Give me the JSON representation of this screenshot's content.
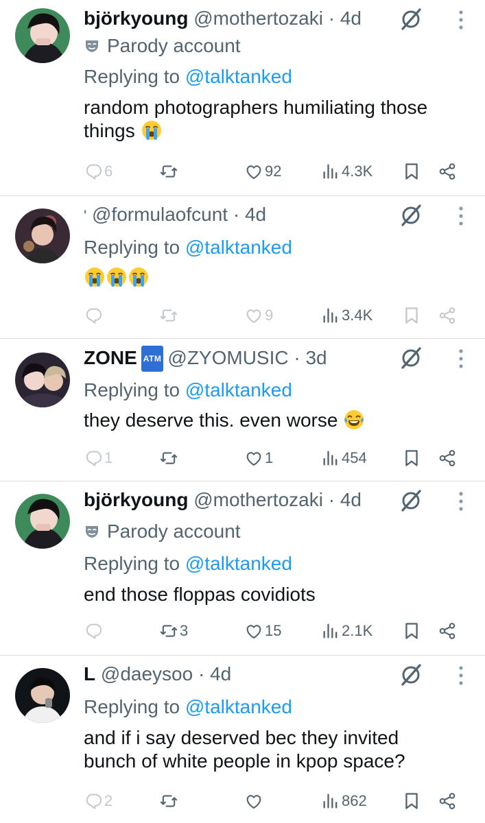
{
  "tweets": [
    {
      "name": "björkyoung",
      "handle": "@mothertozaki",
      "time": "4d",
      "parody": "Parody account",
      "replying_prefix": "Replying to",
      "replying_to": "@talktanked",
      "text_lines": [
        "random photographers humiliating those",
        "things"
      ],
      "emoji": [
        "crying-face"
      ],
      "replies": "6",
      "reposts": "",
      "likes": "92",
      "views": "4.3K"
    },
    {
      "name": "'",
      "handle": "@formulaofcunt",
      "time": "4d",
      "replying_prefix": "Replying to",
      "replying_to": "@talktanked",
      "emoji": [
        "crying-face",
        "crying-face",
        "crying-face"
      ],
      "replies": "",
      "reposts": "",
      "likes": "9",
      "views": "3.4K"
    },
    {
      "name": "ZONE",
      "badge": "ATM",
      "handle": "@ZYOMUSIC",
      "time": "3d",
      "replying_prefix": "Replying to",
      "replying_to": "@talktanked",
      "text_lines": [
        "they deserve this. even worse"
      ],
      "emoji": [
        "laughing-tears-face"
      ],
      "replies": "1",
      "reposts": "",
      "likes": "1",
      "views": "454"
    },
    {
      "name": "björkyoung",
      "handle": "@mothertozaki",
      "time": "4d",
      "parody": "Parody account",
      "replying_prefix": "Replying to",
      "replying_to": "@talktanked",
      "text_lines": [
        "end those floppas covidiots"
      ],
      "replies": "",
      "reposts": "3",
      "likes": "15",
      "views": "2.1K"
    },
    {
      "name": "L",
      "handle": "@daeysoo",
      "time": "4d",
      "replying_prefix": "Replying to",
      "replying_to": "@talktanked",
      "text_lines": [
        "and if i say deserved bec they invited",
        "bunch of white people in kpop space?"
      ],
      "replies": "2",
      "reposts": "",
      "likes": "",
      "views": "862"
    }
  ],
  "separator": "·",
  "colors": {
    "text": "#0f1419",
    "secondary": "#536471",
    "link": "#1d9bf0",
    "divider": "#dadfe3",
    "badge": "#2d6fd4"
  },
  "icons": [
    "grok-icon",
    "more-icon",
    "reply-icon",
    "repost-icon",
    "like-icon",
    "views-icon",
    "bookmark-icon",
    "share-icon",
    "parody-mask-icon"
  ]
}
